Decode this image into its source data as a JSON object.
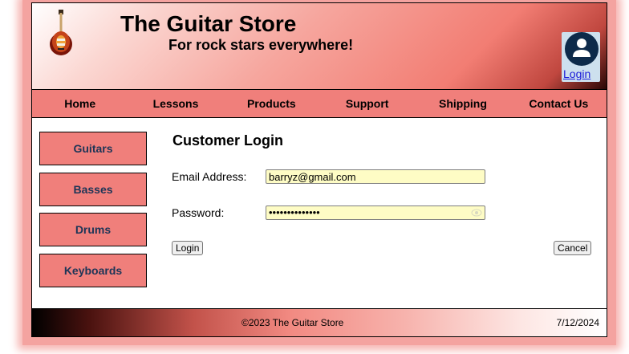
{
  "header": {
    "title": "The Guitar Store",
    "tagline": "For rock stars everywhere!",
    "login_label": "Login"
  },
  "nav": {
    "items": [
      "Home",
      "Lessons",
      "Products",
      "Support",
      "Shipping",
      "Contact Us"
    ]
  },
  "sidebar": {
    "items": [
      "Guitars",
      "Basses",
      "Drums",
      "Keyboards"
    ]
  },
  "login_form": {
    "title": "Customer Login",
    "email_label": "Email Address:",
    "email_value": "barryz@gmail.com",
    "password_label": "Password:",
    "password_masked": "••••••••••••••",
    "login_button": "Login",
    "cancel_button": "Cancel"
  },
  "footer": {
    "copyright": "©2023 The Guitar Store",
    "date": "7/12/2024"
  },
  "colors": {
    "nav_bg": "#f07f7b",
    "input_bg": "#fefcc5",
    "link": "#1a1ad8",
    "sidebar_text": "#1d3557"
  },
  "icons": {
    "logo": "guitar-icon",
    "user": "user-avatar-icon",
    "password_toggle": "eye-icon"
  }
}
